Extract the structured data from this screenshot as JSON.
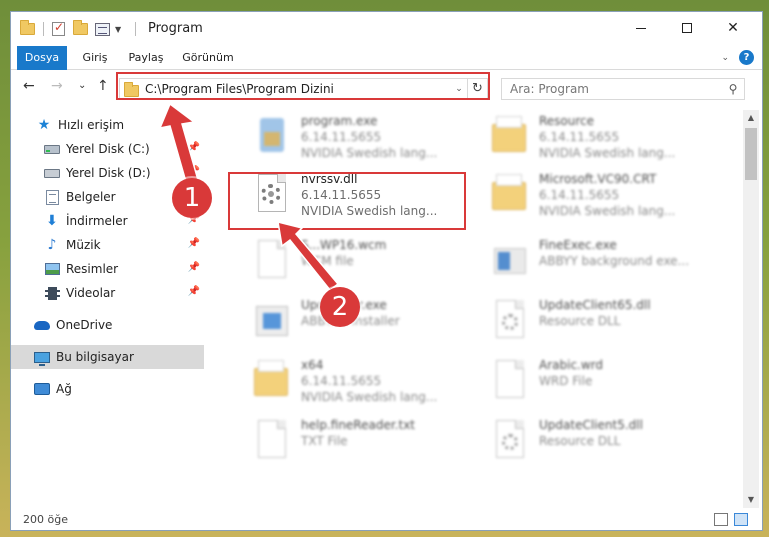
{
  "window": {
    "title": "Program",
    "controls": {
      "minimize": "",
      "maximize": "",
      "close": "✕"
    }
  },
  "ribbon": {
    "tabs": [
      "Dosya",
      "Giriş",
      "Paylaş",
      "Görünüm"
    ],
    "help": "?",
    "collapse": "⌄"
  },
  "navigation": {
    "back": "←",
    "forward": "→",
    "recent": "⌄",
    "up": "↑",
    "address": "C:\\Program Files\\Program Dizini",
    "address_dropdown": "⌄",
    "refresh": "↻",
    "search_placeholder": "Ara: Program",
    "search_icon": "⚲"
  },
  "sidebar": {
    "items": [
      {
        "label": "Hızlı erişim",
        "icon": "star-icon",
        "pinned": false
      },
      {
        "label": "Yerel Disk (C:)",
        "icon": "drive-c-icon",
        "pinned": true
      },
      {
        "label": "Yerel Disk (D:)",
        "icon": "drive-d-icon",
        "pinned": true
      },
      {
        "label": "Belgeler",
        "icon": "documents-icon",
        "pinned": true
      },
      {
        "label": "İndirmeler",
        "icon": "downloads-icon",
        "pinned": true
      },
      {
        "label": "Müzik",
        "icon": "music-icon",
        "pinned": true
      },
      {
        "label": "Resimler",
        "icon": "pictures-icon",
        "pinned": true
      },
      {
        "label": "Videolar",
        "icon": "videos-icon",
        "pinned": true
      },
      {
        "label": "OneDrive",
        "icon": "onedrive-icon",
        "pinned": false
      },
      {
        "label": "Bu bilgisayar",
        "icon": "this-pc-icon",
        "pinned": false,
        "selected": true
      },
      {
        "label": "Ağ",
        "icon": "network-icon",
        "pinned": false
      }
    ],
    "pin_glyph": "📌"
  },
  "files": [
    {
      "name": "program.exe",
      "line2": "6.14.11.5655",
      "line3": "NVIDIA Swedish lang...",
      "icon": "program-exe-icon",
      "blurred": true
    },
    {
      "name": "Resource",
      "line2": "6.14.11.5655",
      "line3": "NVIDIA Swedish lang...",
      "icon": "folder-icon",
      "blurred": true
    },
    {
      "name": "nvrssv.dll",
      "line2": "6.14.11.5655",
      "line3": "NVIDIA Swedish lang...",
      "icon": "dll-gear-icon",
      "blurred": false
    },
    {
      "name": "Microsoft.VC90.CRT",
      "line2": "6.14.11.5655",
      "line3": "NVIDIA Swedish lang...",
      "icon": "folder-icon",
      "blurred": true
    },
    {
      "name": "S...WP16.wcm",
      "line2": "WCM file",
      "line3": "",
      "icon": "blank-file-icon",
      "blurred": true
    },
    {
      "name": "FineExec.exe",
      "line2": "ABBYY background exe...",
      "line3": "",
      "icon": "fineexec-icon",
      "blurred": true
    },
    {
      "name": "Upda...ller.exe",
      "line2": "ABBY...s installer",
      "line3": "",
      "icon": "installer-exe-icon",
      "blurred": true
    },
    {
      "name": "UpdateClient65.dll",
      "line2": "Resource DLL",
      "line3": "",
      "icon": "dll-gear-icon",
      "blurred": true
    },
    {
      "name": "x64",
      "line2": "6.14.11.5655",
      "line3": "NVIDIA Swedish lang...",
      "icon": "folder-icon",
      "blurred": true
    },
    {
      "name": "Arabic.wrd",
      "line2": "WRD File",
      "line3": "",
      "icon": "blank-file-icon",
      "blurred": true
    },
    {
      "name": "help.fineReader.txt",
      "line2": "TXT File",
      "line3": "",
      "icon": "text-file-icon",
      "blurred": true
    },
    {
      "name": "UpdateClient5.dll",
      "line2": "Resource DLL",
      "line3": "",
      "icon": "dll-gear-icon",
      "blurred": true
    }
  ],
  "callouts": [
    "1",
    "2"
  ],
  "status": {
    "item_count": "200 öğe"
  },
  "colors": {
    "accent": "#1979ca",
    "highlight": "#d93939",
    "selected_nav": "#d9d9d9"
  }
}
